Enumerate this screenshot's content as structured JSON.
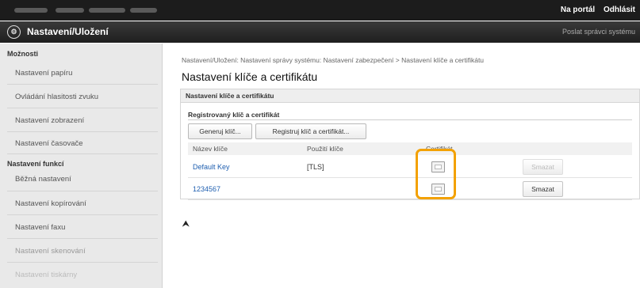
{
  "topbar": {
    "portal_link": "Na portál",
    "logout_link": "Odhlásit"
  },
  "titlebar": {
    "logo_glyph": "⚙",
    "title": "Nastavení/Uložení",
    "admin_link": "Poslat správci systému"
  },
  "sidebar": {
    "section1_label": "Možnosti",
    "items1": [
      "Nastavení papíru",
      "Ovládání hlasitosti zvuku",
      "Nastavení zobrazení",
      "Nastavení časovače"
    ],
    "section2_label": "Nastavení funkcí",
    "items2": [
      "Běžná nastavení",
      "Nastavení kopírování",
      "Nastavení faxu",
      "Nastavení skenování",
      "Nastavení tiskárny"
    ]
  },
  "main": {
    "breadcrumb": "Nastavení/Uložení: Nastavení správy systému: Nastavení zabezpečení > Nastavení klíče a certifikátu",
    "page_title": "Nastavení klíče a certifikátu",
    "section_header": "Nastavení klíče a certifikátu",
    "subsection_title": "Registrovaný klíč a certifikát",
    "generate_key_button": "Generuj klíč...",
    "register_button": "Registruj klíč a certifikát...",
    "columns": [
      "Název klíče",
      "Použití klíče",
      "Certifikát"
    ],
    "rows": [
      {
        "key_name": "Default Key",
        "key_usage": "[TLS]",
        "delete_label": "Smazat",
        "delete_enabled": false
      },
      {
        "key_name": "1234567",
        "key_usage": "",
        "delete_label": "Smazat",
        "delete_enabled": true
      }
    ],
    "to_top_glyph": "⮝"
  },
  "colors": {
    "highlight": "#f3a100",
    "link": "#1f5fb0"
  }
}
